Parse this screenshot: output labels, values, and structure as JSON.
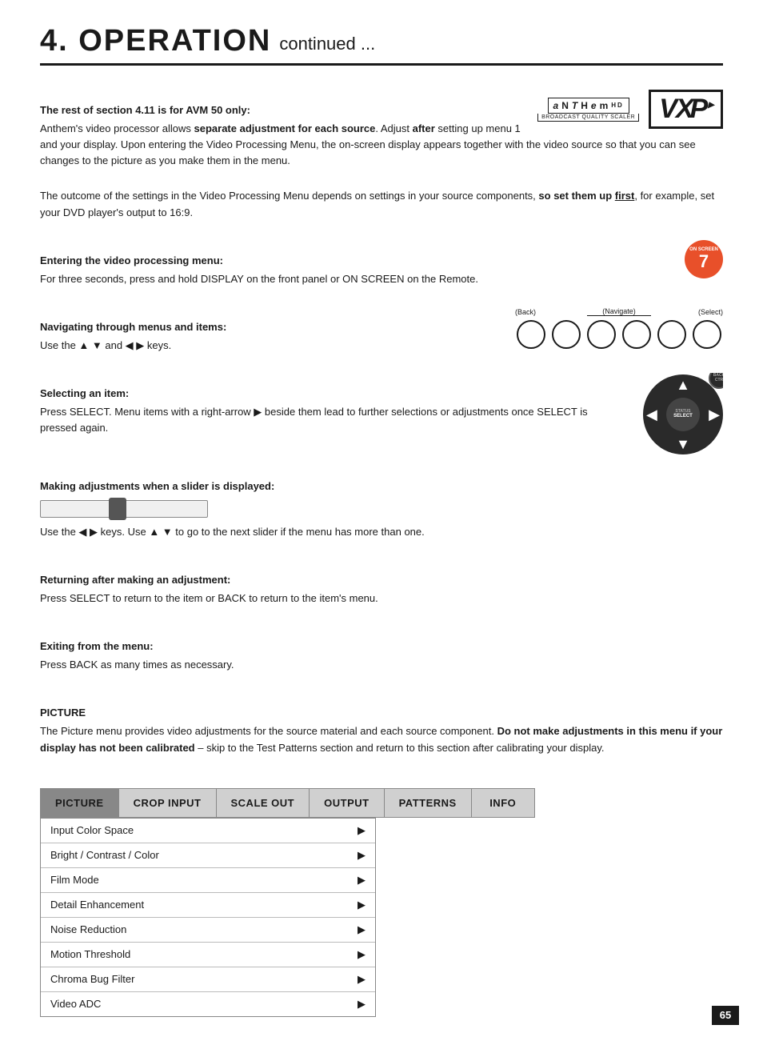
{
  "header": {
    "title": "4. OPERATION",
    "subtitle": "continued ...",
    "line_rule": true
  },
  "logos": {
    "anthem": {
      "top": "aNTHEmHD",
      "bottom": "BROADCAST QUALITY SCALER"
    },
    "vxp": "VXP"
  },
  "on_screen_badge": {
    "label": "ON SCREEN",
    "number": "7"
  },
  "sections": [
    {
      "id": "avm50-heading",
      "heading": "The rest of section 4.11 is for AVM 50 only:",
      "body": "Anthem's video processor allows separate adjustment for each source. Adjust after setting up menu 1 and your display. Upon entering the Video Processing Menu, the on-screen display appears together with the video source so that you can see changes to the picture as you make them in the menu."
    },
    {
      "id": "outcome",
      "body": "The outcome of the settings in the Video Processing Menu depends on settings in your source components, so set them up first, for example, set your DVD player's output to 16:9."
    },
    {
      "id": "entering-menu",
      "heading": "Entering the video processing menu:",
      "body": "For three seconds, press and hold DISPLAY on the front panel or ON SCREEN on the Remote."
    },
    {
      "id": "navigating",
      "heading": "Navigating through menus and items:",
      "body": "Use the ▲ ▼  and  ◀ ▶  keys."
    },
    {
      "id": "selecting",
      "heading": "Selecting an item:",
      "body": "Press SELECT. Menu items with a right-arrow ▶ beside them lead to further selections or adjustments once SELECT is pressed again."
    },
    {
      "id": "slider",
      "heading": "Making adjustments when a slider is displayed:",
      "body": "Use the ◀ ▶ keys. Use ▲ ▼  to go to the next slider if the menu has more than one."
    },
    {
      "id": "returning",
      "heading": "Returning after making an adjustment:",
      "body": "Press SELECT to return to the item or BACK to return to the item's menu."
    },
    {
      "id": "exiting",
      "heading": "Exiting from the menu:",
      "body": "Press BACK as many times as necessary."
    },
    {
      "id": "picture",
      "heading": "PICTURE",
      "body": "The Picture menu provides video adjustments for the source material and each source component. Do not make adjustments in this menu if your display has not been calibrated – skip to the Test Patterns section and return to this section after calibrating your display."
    }
  ],
  "nav_buttons": {
    "labels": {
      "back": "(Back)",
      "navigate": "(Navigate)",
      "select": "(Select)"
    }
  },
  "dpad": {
    "back_label": "BACK",
    "status_label": "STATUS",
    "select_label": "SELECT"
  },
  "menu_tabs": [
    {
      "id": "picture",
      "label": "PICTURE",
      "active": true
    },
    {
      "id": "crop_input",
      "label": "CROP INPUT",
      "active": false
    },
    {
      "id": "scale_out",
      "label": "SCALE OUT",
      "active": false
    },
    {
      "id": "output",
      "label": "OUTPUT",
      "active": false
    },
    {
      "id": "patterns",
      "label": "PATTERNS",
      "active": false
    },
    {
      "id": "info",
      "label": "INFO",
      "active": false
    }
  ],
  "menu_items": [
    {
      "label": "Input Color Space",
      "has_arrow": true
    },
    {
      "label": "Bright / Contrast / Color",
      "has_arrow": true
    },
    {
      "label": "Film Mode",
      "has_arrow": true
    },
    {
      "label": "Detail Enhancement",
      "has_arrow": true
    },
    {
      "label": "Noise Reduction",
      "has_arrow": true
    },
    {
      "label": "Motion Threshold",
      "has_arrow": true
    },
    {
      "label": "Chroma Bug Filter",
      "has_arrow": true
    },
    {
      "label": "Video ADC",
      "has_arrow": true
    }
  ],
  "page_number": "65"
}
